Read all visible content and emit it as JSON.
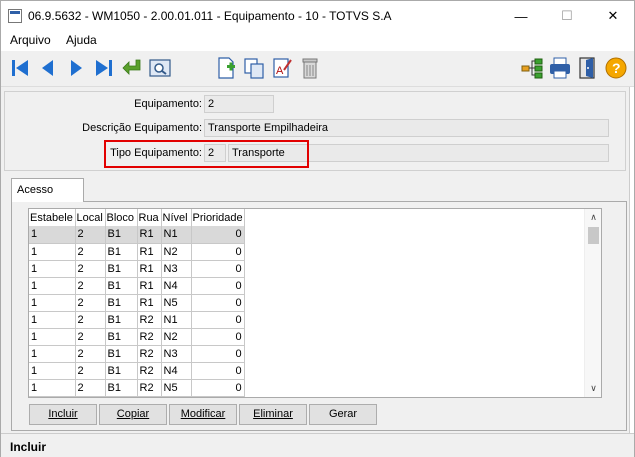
{
  "window": {
    "title": "06.9.5632 - WM1050 - 2.00.01.011 - Equipamento - 10 - TOTVS S.A",
    "minimize": "—",
    "maximize": "☐",
    "close": "✕"
  },
  "menu": {
    "arquivo": "Arquivo",
    "ajuda": "Ajuda"
  },
  "toolbar": {
    "buttons": [
      "first-icon",
      "previous-icon",
      "next-icon",
      "last-icon",
      "goto-icon",
      "search-icon",
      "add-icon",
      "copy-icon",
      "edit-icon",
      "delete-icon",
      "tree-icon",
      "print-icon",
      "exit-icon",
      "help-icon"
    ]
  },
  "form": {
    "equipamento_label": "Equipamento:",
    "equipamento_value": "2",
    "descricao_label": "Descrição Equipamento:",
    "descricao_value": "Transporte Empilhadeira",
    "tipo_label": "Tipo Equipamento:",
    "tipo_code": "2",
    "tipo_desc": "Transporte"
  },
  "tabs": {
    "acesso": "Acesso"
  },
  "grid": {
    "columns": [
      "Estabele",
      "Local",
      "Bloco",
      "Rua",
      "Nível",
      "Prioridade"
    ],
    "rows": [
      [
        "1",
        "2",
        "B1",
        "R1",
        "N1",
        "0"
      ],
      [
        "1",
        "2",
        "B1",
        "R1",
        "N2",
        "0"
      ],
      [
        "1",
        "2",
        "B1",
        "R1",
        "N3",
        "0"
      ],
      [
        "1",
        "2",
        "B1",
        "R1",
        "N4",
        "0"
      ],
      [
        "1",
        "2",
        "B1",
        "R1",
        "N5",
        "0"
      ],
      [
        "1",
        "2",
        "B1",
        "R2",
        "N1",
        "0"
      ],
      [
        "1",
        "2",
        "B1",
        "R2",
        "N2",
        "0"
      ],
      [
        "1",
        "2",
        "B1",
        "R2",
        "N3",
        "0"
      ],
      [
        "1",
        "2",
        "B1",
        "R2",
        "N4",
        "0"
      ],
      [
        "1",
        "2",
        "B1",
        "R2",
        "N5",
        "0"
      ]
    ]
  },
  "buttons": {
    "incluir": "Incluir",
    "copiar": "Copiar",
    "modificar": "Modificar",
    "eliminar": "Eliminar",
    "gerar": "Gerar"
  },
  "status": "Incluir",
  "colors": {
    "highlight": "#e20000",
    "nav_blue": "#1f6fd0"
  }
}
